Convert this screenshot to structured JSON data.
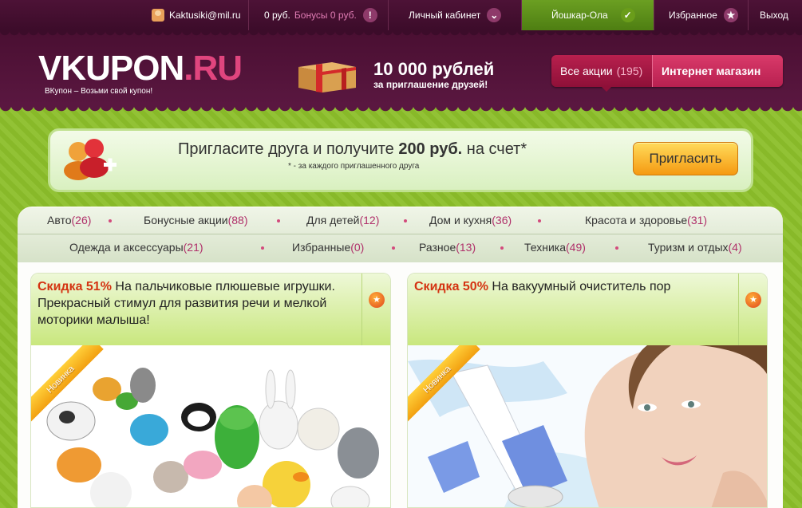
{
  "topbar": {
    "email": "Kaktusiki@mil.ru",
    "balance": "0 руб.",
    "bonus": "Бонусы 0 руб.",
    "cabinet": "Личный кабинет",
    "city": "Йошкар-Ола",
    "favorites": "Избранное",
    "logout": "Выход"
  },
  "header": {
    "logo_main": "VKUPON",
    "logo_suffix": ".RU",
    "tagline": "ВКупон – Возьми свой купон!",
    "promo_title": "10 000 рублей",
    "promo_sub": "за приглашение друзей!",
    "tab_all_label": "Все акции",
    "tab_all_count": "(195)",
    "tab_shop_label": "Интернет магазин"
  },
  "invite": {
    "title_start": "Пригласите друга и получите ",
    "title_bold": "200 руб.",
    "title_end": " на счет*",
    "note": "* - за каждого приглашенного друга",
    "button": "Пригласить"
  },
  "categories": [
    {
      "label": "Авто",
      "count": "(26)"
    },
    {
      "label": "Бонусные акции",
      "count": "(88)"
    },
    {
      "label": "Для детей",
      "count": "(12)"
    },
    {
      "label": "Дом и кухня",
      "count": "(36)"
    },
    {
      "label": "Красота и здоровье",
      "count": "(31)"
    },
    {
      "label": "Одежда и аксессуары",
      "count": "(21)"
    },
    {
      "label": "Избранные",
      "count": "(0)"
    },
    {
      "label": "Разное",
      "count": "(13)"
    },
    {
      "label": "Техника",
      "count": "(49)"
    },
    {
      "label": "Туризм и отдых",
      "count": "(4)"
    }
  ],
  "deals": [
    {
      "discount": "Скидка 51%",
      "text": "На пальчиковые плюшевые игрушки. Прекрасный стимул для развития речи и мелкой моторики малыша!",
      "ribbon": "Новинка"
    },
    {
      "discount": "Скидка 50%",
      "text": "На вакуумный очиститель пор",
      "ribbon": "Новинка"
    }
  ],
  "colors": {
    "brand": "#4a0f32",
    "accent": "#e0457e",
    "page_bg": "#8cbf2a",
    "discount": "#d43312",
    "button": "#f59a12"
  },
  "icons": [
    "user-icon",
    "bonus-info-icon",
    "chevron-down-icon",
    "check-icon",
    "star-icon",
    "gift-box-icon",
    "people-add-icon",
    "favorite-star-icon"
  ]
}
